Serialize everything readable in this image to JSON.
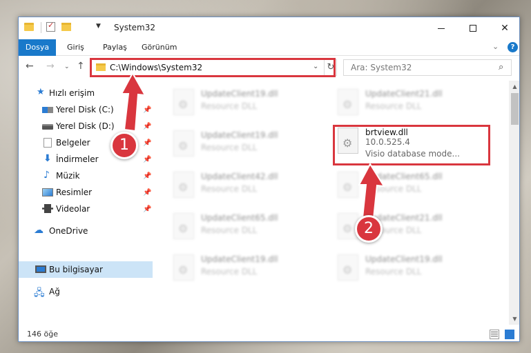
{
  "window": {
    "title": "System32"
  },
  "ribbon": {
    "tabs": [
      "Dosya",
      "Giriş",
      "Paylaş",
      "Görünüm"
    ]
  },
  "nav": {
    "address": "C:\\Windows\\System32",
    "search_placeholder": "Ara: System32"
  },
  "sidebar": {
    "items": [
      {
        "label": "Hızlı erişim",
        "icon": "star-icon"
      },
      {
        "label": "Yerel Disk (C:)",
        "icon": "drive-icon",
        "pinned": true
      },
      {
        "label": "Yerel Disk (D:)",
        "icon": "drive-icon",
        "pinned": true
      },
      {
        "label": "Belgeler",
        "icon": "documents-icon",
        "pinned": true
      },
      {
        "label": "İndirmeler",
        "icon": "downloads-icon",
        "pinned": true
      },
      {
        "label": "Müzik",
        "icon": "music-icon",
        "pinned": true
      },
      {
        "label": "Resimler",
        "icon": "pictures-icon",
        "pinned": true
      },
      {
        "label": "Videolar",
        "icon": "videos-icon",
        "pinned": true
      },
      {
        "label": "OneDrive",
        "icon": "cloud-icon"
      },
      {
        "label": "Bu bilgisayar",
        "icon": "pc-icon",
        "selected": true
      },
      {
        "label": "Ağ",
        "icon": "network-icon"
      }
    ]
  },
  "files": [
    {
      "name": "UpdateClient19.dll",
      "desc": "Resource DLL",
      "blurred": true
    },
    {
      "name": "UpdateClient21.dll",
      "desc": "Resource DLL",
      "blurred": true
    },
    {
      "name": "UpdateClient19.dll",
      "desc": "Resource DLL",
      "blurred": true
    },
    {
      "name": "brtview.dll",
      "desc": "10.0.525.4",
      "desc2": "Visio database mode...",
      "blurred": false
    },
    {
      "name": "UpdateClient42.dll",
      "desc": "Resource DLL",
      "blurred": true
    },
    {
      "name": "UpdateClient65.dll",
      "desc": "Resource DLL",
      "blurred": true
    },
    {
      "name": "UpdateClient65.dll",
      "desc": "Resource DLL",
      "blurred": true
    },
    {
      "name": "UpdateClient21.dll",
      "desc": "Resource DLL",
      "blurred": true
    },
    {
      "name": "UpdateClient19.dll",
      "desc": "Resource DLL",
      "blurred": true
    },
    {
      "name": "UpdateClient19.dll",
      "desc": "Resource DLL",
      "blurred": true
    }
  ],
  "status": {
    "item_count": "146 öğe"
  },
  "annotations": {
    "badge1": "1",
    "badge2": "2",
    "color": "#d9363e"
  }
}
